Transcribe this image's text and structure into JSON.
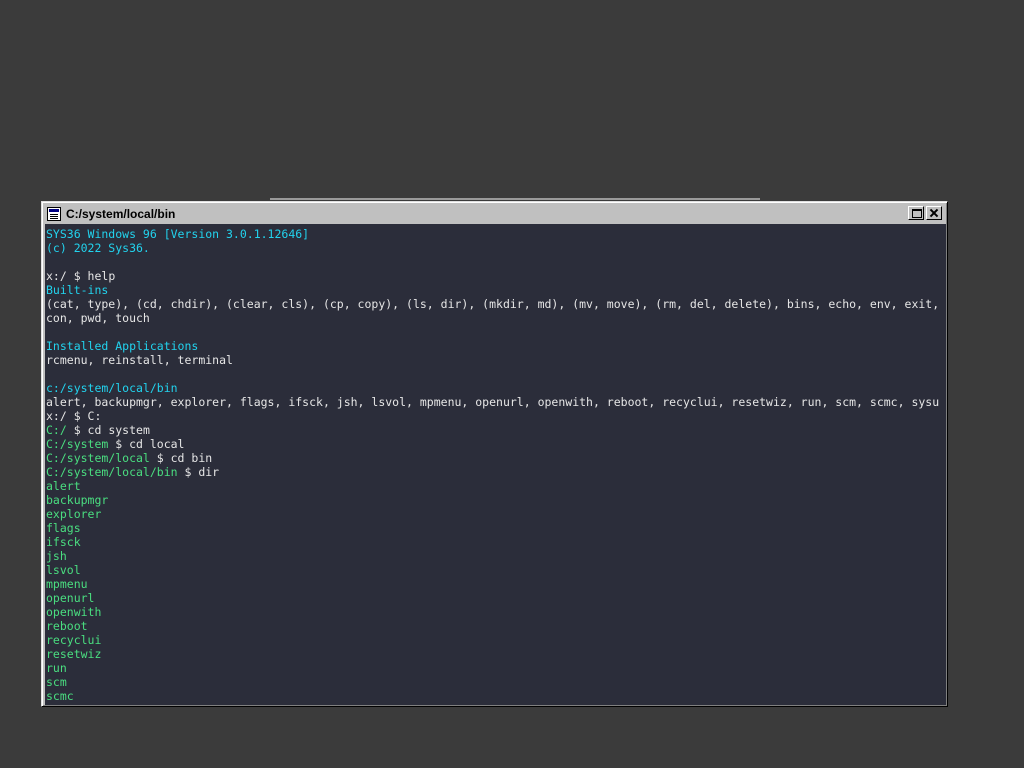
{
  "window": {
    "title": "C:/system/local/bin",
    "icon": "terminal-window-icon",
    "maximize_icon": "maximize-icon",
    "close_icon": "close-icon"
  },
  "colors": {
    "terminal_bg": "#2b2d3a",
    "text": "#e6e6e6",
    "cyan": "#22d3ee",
    "green": "#4ade80",
    "desktop_bg": "#3b3b3b"
  },
  "terminal": {
    "banner": [
      "SYS36 Windows 96 [Version 3.0.1.12646]",
      "(c) 2022 Sys36."
    ],
    "help_prompt": "x:/",
    "help_cmd": " $ help",
    "builtins_header": "Built-ins",
    "builtins_line1": "(cat, type), (cd, chdir), (clear, cls), (cp, copy), (ls, dir), (mkdir, md), (mv, move), (rm, del, delete), bins, echo, env, exit,",
    "builtins_line2": "con, pwd, touch",
    "apps_header": "Installed Applications",
    "apps_list": "rcmenu, reinstall, terminal",
    "bin_header": "c:/system/local/bin",
    "bin_list": "alert, backupmgr, explorer, flags, ifsck, jsh, lsvol, mpmenu, openurl, openwith, reboot, recyclui, resetwiz, run, scm, scmc, sysu",
    "history": [
      {
        "prompt": "x:/",
        "cmd": " $ C:"
      },
      {
        "prompt": "C:/",
        "cmd": " $ cd system"
      },
      {
        "prompt": "C:/system",
        "cmd": " $ cd local"
      },
      {
        "prompt": "C:/system/local",
        "cmd": " $ cd bin"
      },
      {
        "prompt": "C:/system/local/bin",
        "cmd": " $ dir"
      }
    ],
    "dir_listing": [
      "alert",
      "backupmgr",
      "explorer",
      "flags",
      "ifsck",
      "jsh",
      "lsvol",
      "mpmenu",
      "openurl",
      "openwith",
      "reboot",
      "recyclui",
      "resetwiz",
      "run",
      "scm",
      "scmc"
    ]
  }
}
